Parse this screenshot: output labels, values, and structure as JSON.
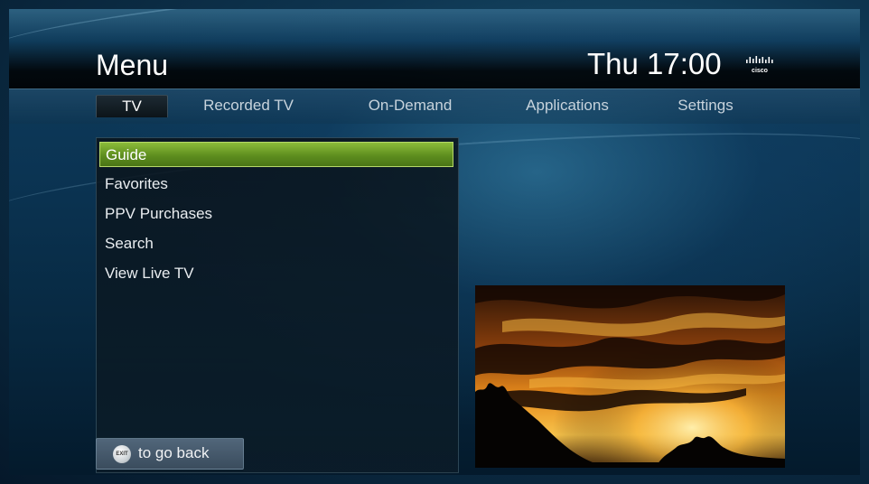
{
  "header": {
    "title": "Menu",
    "clock": "Thu 17:00",
    "brand_icon": "cisco-logo"
  },
  "tabs": [
    {
      "label": "TV",
      "active": true
    },
    {
      "label": "Recorded TV",
      "active": false
    },
    {
      "label": "On-Demand",
      "active": false
    },
    {
      "label": "Applications",
      "active": false
    },
    {
      "label": "Settings",
      "active": false
    }
  ],
  "menu": {
    "items": [
      {
        "label": "Guide",
        "selected": true
      },
      {
        "label": "Favorites",
        "selected": false
      },
      {
        "label": "PPV Purchases",
        "selected": false
      },
      {
        "label": "Search",
        "selected": false
      },
      {
        "label": "View Live TV",
        "selected": false
      }
    ]
  },
  "exit_hint": {
    "button_icon": "exit-button-icon",
    "label": "to go back"
  },
  "preview": {
    "subject": "video-preview"
  },
  "colors": {
    "selection": "#7aaa2e",
    "background": "#0b3453",
    "header_bar": "#000000"
  }
}
